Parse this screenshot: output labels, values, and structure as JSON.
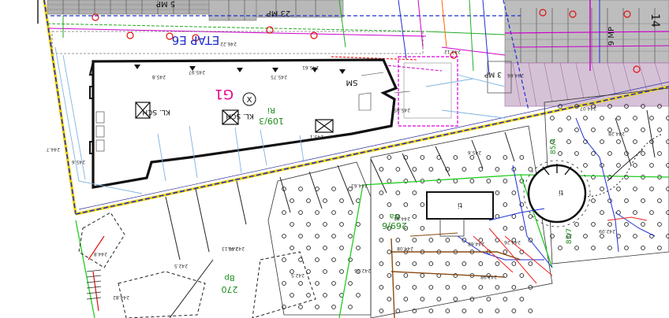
{
  "labels": {
    "etap": "ETAP E6",
    "building": "G1",
    "x_mark": "X",
    "plot_a": "109/3",
    "plot_a_sub": "Ri",
    "plot_b": "269/6",
    "plot_b_sub": "Ba",
    "plot_c": "270",
    "plot_c_sub": "Bp",
    "mp5": "5 MP",
    "mp23": "23 MP",
    "mp9": "9 MP",
    "mp3": "3 MP",
    "p14": "14",
    "kl_sch": "KL. SCH",
    "kl_sch2": "KL. SCH",
    "sm": "SM",
    "circle_label": "ti",
    "box_label": "ti",
    "lbl_854": "85/4",
    "lbl_857": "85/7",
    "lbl_2": "2"
  },
  "elevations": [
    {
      "t": "245.8"
    },
    {
      "t": "245.97"
    },
    {
      "t": "245.75"
    },
    {
      "t": "245.61"
    },
    {
      "t": "245.1"
    },
    {
      "t": "246.22"
    },
    {
      "t": "244.7"
    },
    {
      "t": "245.85"
    },
    {
      "t": "244.63"
    },
    {
      "t": "242.75"
    },
    {
      "t": "244.8"
    },
    {
      "t": "245.6"
    },
    {
      "t": "244.82"
    },
    {
      "t": "244.13"
    },
    {
      "t": "242.5"
    },
    {
      "t": "242.5"
    },
    {
      "t": "242.36"
    },
    {
      "t": "244.01"
    },
    {
      "t": "244.66"
    },
    {
      "t": "244.68"
    },
    {
      "t": "244.26"
    },
    {
      "t": "245.6"
    },
    {
      "t": "243.12"
    },
    {
      "t": "244.07"
    },
    {
      "t": "244.28"
    },
    {
      "t": "242.09"
    },
    {
      "t": "243.98"
    },
    {
      "t": "244.08"
    }
  ]
}
